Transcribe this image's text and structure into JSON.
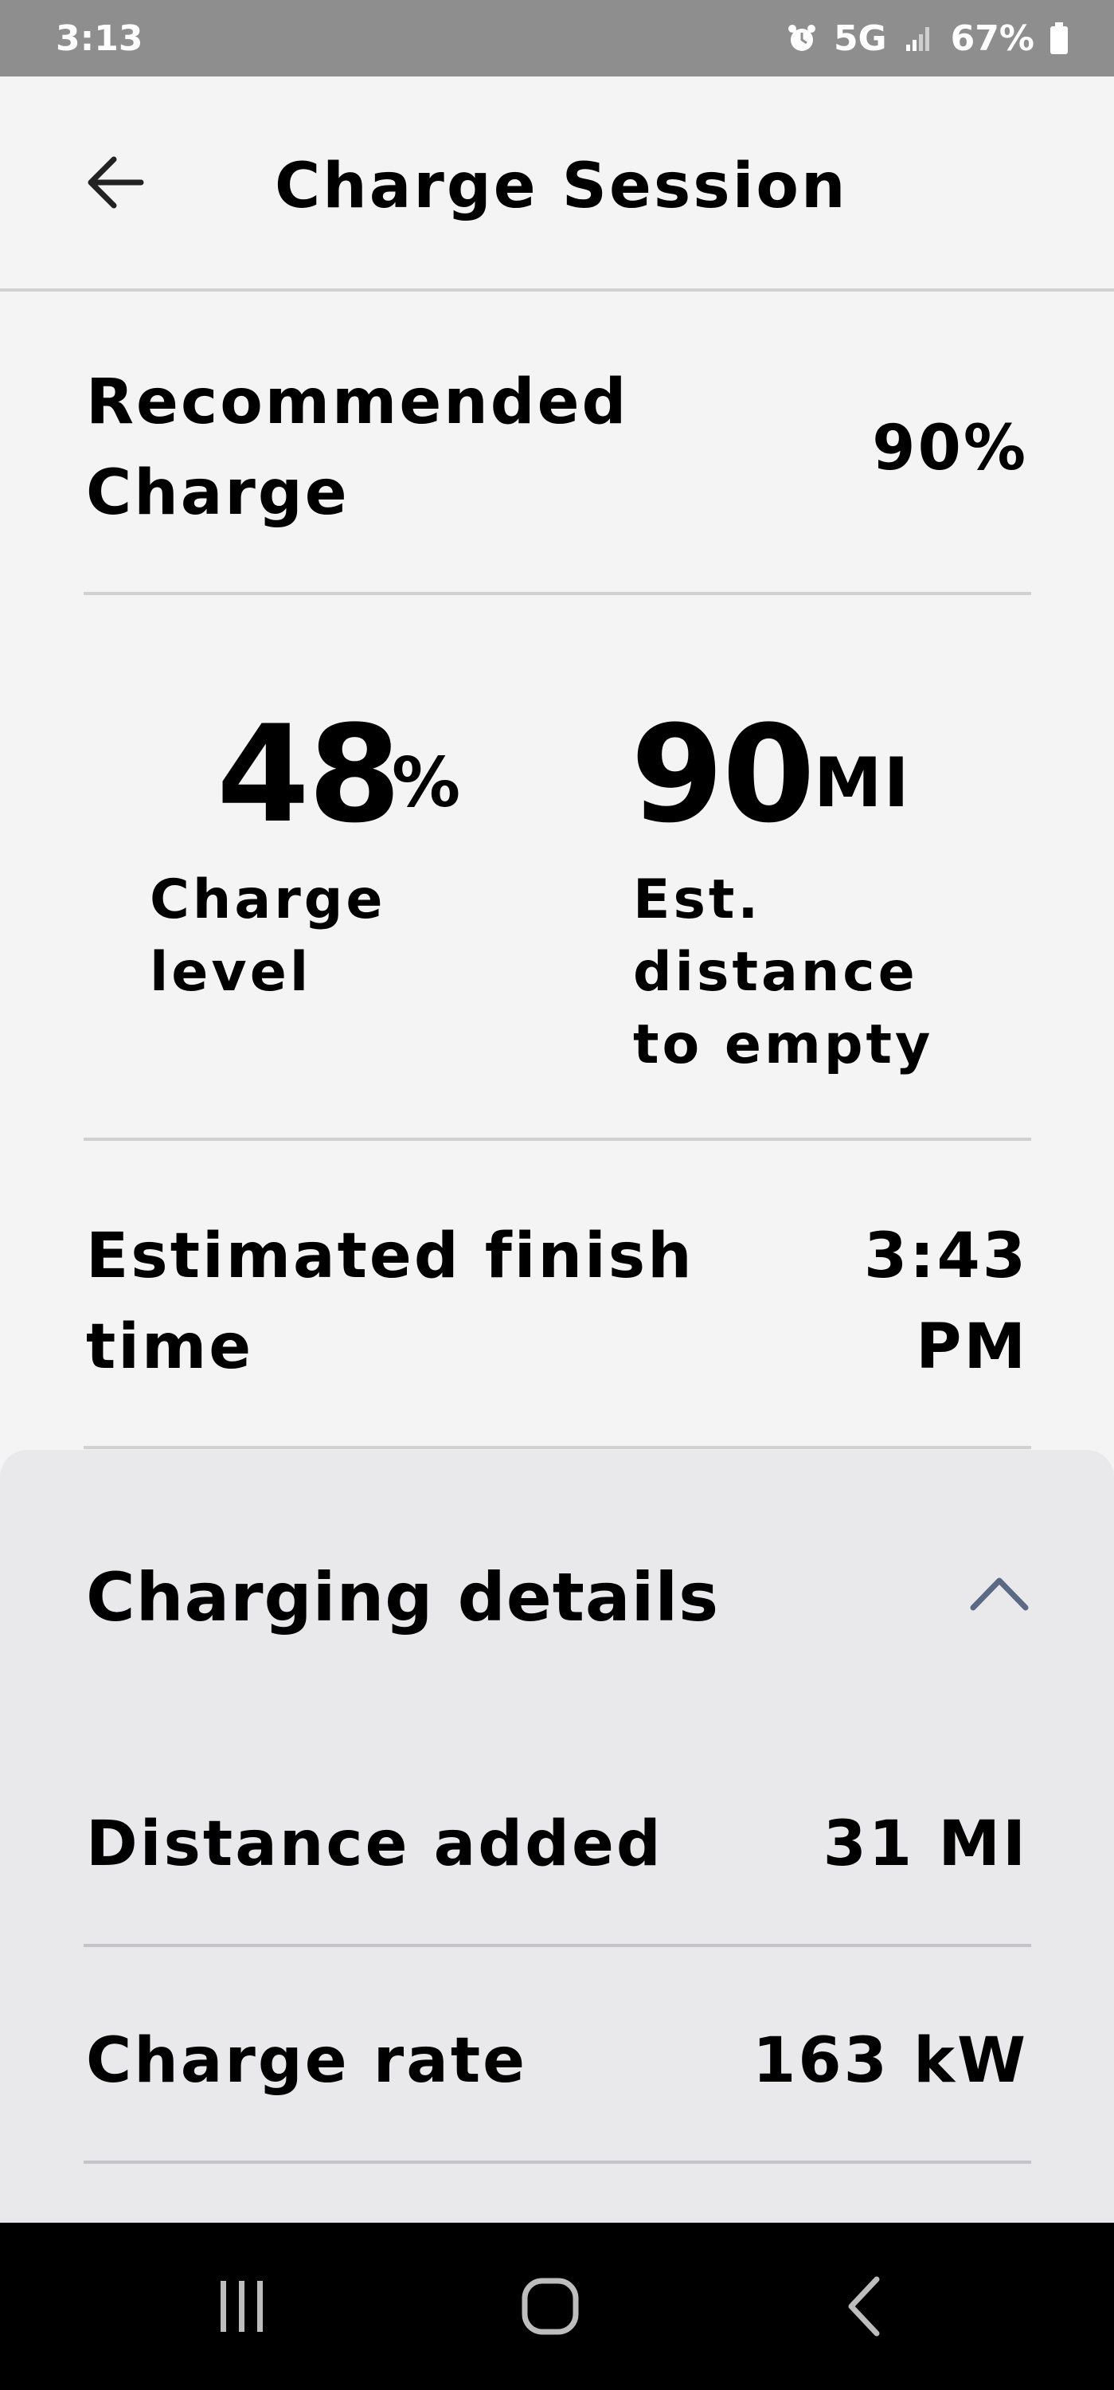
{
  "status_bar": {
    "time": "3:13",
    "network": "5G",
    "battery": "67%",
    "icons": [
      "alarm-icon",
      "signal-icon",
      "battery-icon"
    ]
  },
  "header": {
    "title": "Charge Session",
    "back_icon": "arrow-left-icon"
  },
  "recommended": {
    "label": "Recommended Charge",
    "label_line1": "Recommended",
    "label_line2": "Charge",
    "value": "90%"
  },
  "metrics": {
    "charge_level": {
      "value": "48",
      "unit": "%",
      "caption_line1": "Charge",
      "caption_line2": "level"
    },
    "distance_to_empty": {
      "value": "90",
      "unit": "MI",
      "caption_line1": "Est.",
      "caption_line2": "distance",
      "caption_line3": "to empty"
    }
  },
  "finish_time": {
    "label_line1": "Estimated finish",
    "label_line2": "time",
    "value_line1": "3:43",
    "value_line2": "PM"
  },
  "details": {
    "title": "Charging details",
    "toggle_icon": "chevron-up-icon",
    "rows": [
      {
        "label": "Distance added",
        "value": "31 MI"
      },
      {
        "label": "Charge rate",
        "value": "163 kW"
      }
    ]
  },
  "nav_bar": {
    "icons": [
      "recent-apps-icon",
      "home-icon",
      "back-icon"
    ]
  },
  "colors": {
    "status_bar_bg": "#8e8e8e",
    "page_bg": "#f4f4f4",
    "details_bg": "#e9e9eb",
    "divider": "#d0d0d0",
    "chevron": "#5a6a85",
    "nav_bar_bg": "#000000"
  }
}
